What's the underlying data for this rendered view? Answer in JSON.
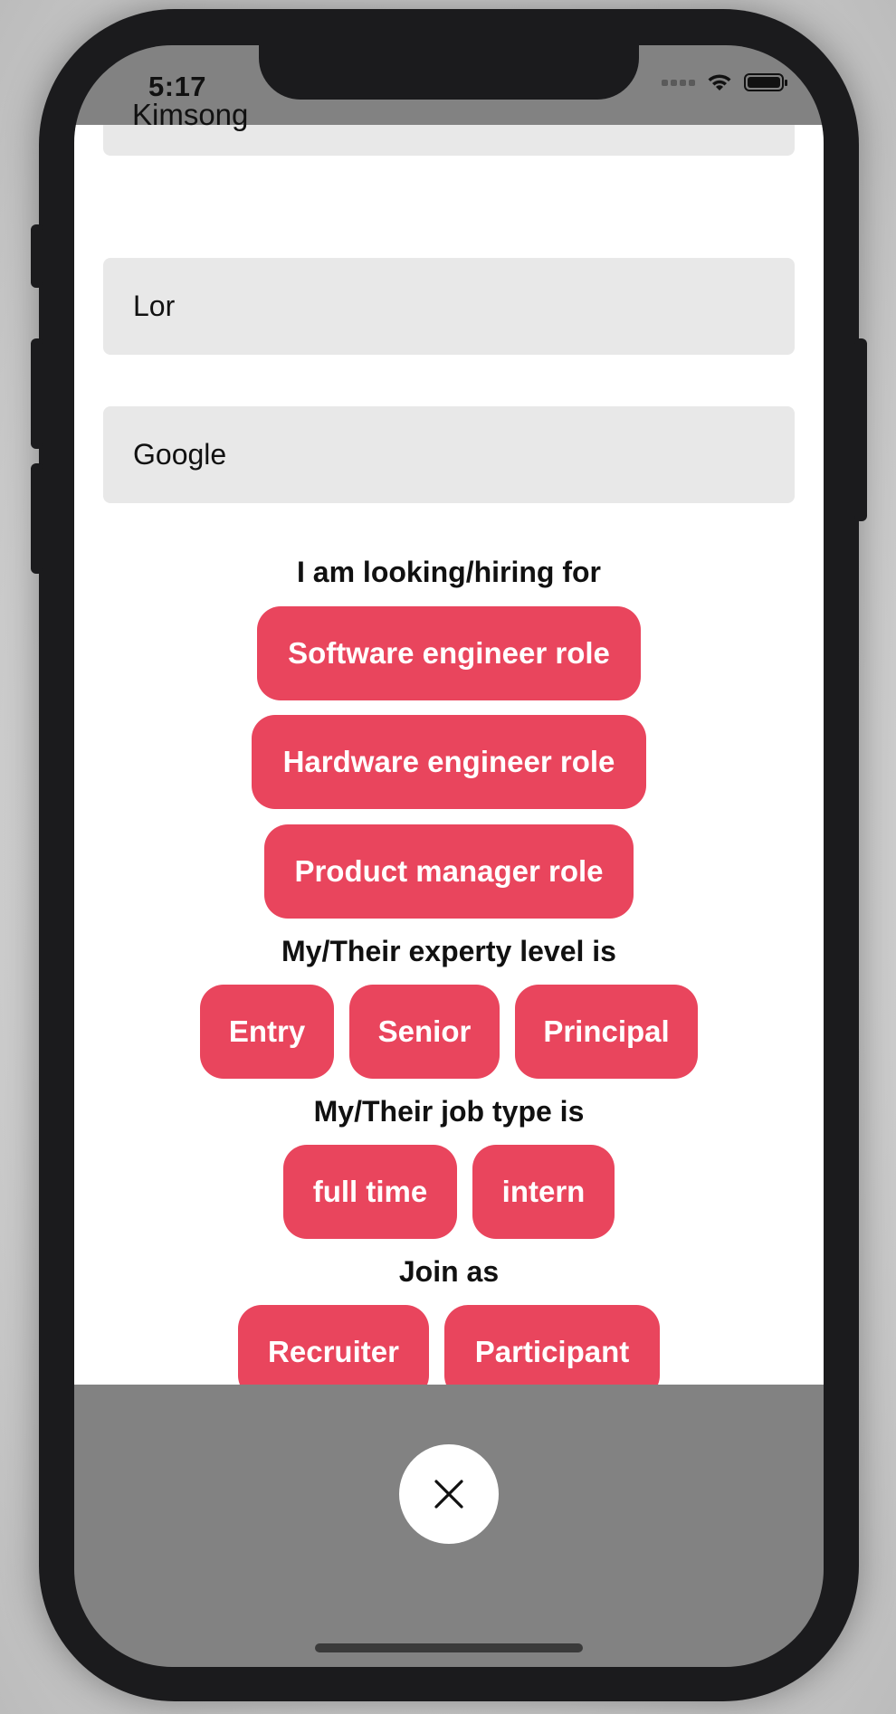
{
  "status_bar": {
    "time": "5:17"
  },
  "form": {
    "first_name_partial": "Kimsong",
    "last_name_value": "Lor",
    "company_value": "Google"
  },
  "sections": {
    "role": {
      "label": "I am looking/hiring for",
      "options": [
        "Software engineer role",
        "Hardware engineer role",
        "Product manager role"
      ]
    },
    "expertise": {
      "label": "My/Their experty level is",
      "options": [
        "Entry",
        "Senior",
        "Principal"
      ]
    },
    "job_type": {
      "label": "My/Their job type is",
      "options": [
        "full time",
        "intern"
      ]
    },
    "join_as": {
      "label": "Join as",
      "options": [
        "Recruiter",
        "Participant"
      ]
    }
  },
  "colors": {
    "chip_background": "#e9455d",
    "field_background": "#e8e8e8",
    "overlay_background": "#828282"
  },
  "icons": {
    "close": "close-icon"
  }
}
